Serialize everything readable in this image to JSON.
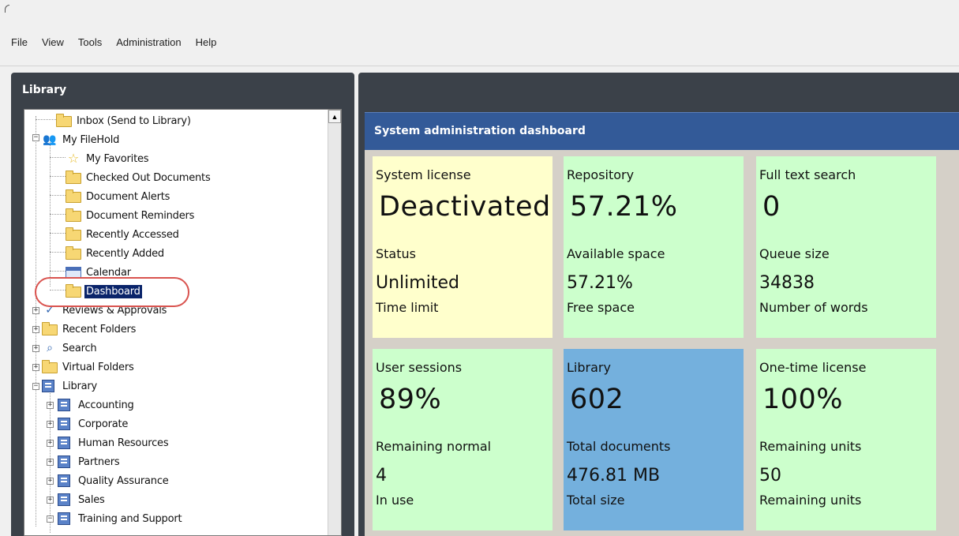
{
  "menu": [
    "File",
    "View",
    "Tools",
    "Administration",
    "Help"
  ],
  "library_pane": {
    "title": "Library",
    "tree": [
      {
        "label": "Inbox (Send to Library)",
        "icon": "folder-icon"
      },
      {
        "label": "My FileHold",
        "icon": "users-icon"
      },
      {
        "label": "My Favorites",
        "icon": "star-icon"
      },
      {
        "label": "Checked Out Documents",
        "icon": "folder-icon"
      },
      {
        "label": "Document Alerts",
        "icon": "folder-icon"
      },
      {
        "label": "Document Reminders",
        "icon": "folder-icon"
      },
      {
        "label": "Recently Accessed",
        "icon": "folder-icon"
      },
      {
        "label": "Recently Added",
        "icon": "folder-icon"
      },
      {
        "label": "Calendar",
        "icon": "calendar-icon"
      },
      {
        "label": "Dashboard",
        "icon": "folder-icon"
      },
      {
        "label": "Reviews & Approvals",
        "icon": "approval-icon"
      },
      {
        "label": "Recent Folders",
        "icon": "folders-icon"
      },
      {
        "label": "Search",
        "icon": "search-icon"
      },
      {
        "label": "Virtual Folders",
        "icon": "folders-icon"
      },
      {
        "label": "Library",
        "icon": "library-icon"
      },
      {
        "label": "Accounting",
        "icon": "cabinet-icon"
      },
      {
        "label": "Corporate",
        "icon": "cabinet-icon"
      },
      {
        "label": "Human Resources",
        "icon": "cabinet-icon"
      },
      {
        "label": "Partners",
        "icon": "cabinet-icon"
      },
      {
        "label": "Quality Assurance",
        "icon": "cabinet-icon"
      },
      {
        "label": "Sales",
        "icon": "cabinet-icon"
      },
      {
        "label": "Training and Support",
        "icon": "cabinet-icon"
      }
    ],
    "selected_item": "Dashboard"
  },
  "dashboard": {
    "title": "System administration dashboard",
    "cards": [
      {
        "title": "System license",
        "big": "Deactivated",
        "sub": "Status",
        "mid": "Unlimited",
        "foot": "Time limit",
        "color": "#ffffcc"
      },
      {
        "title": "Repository",
        "big": "57.21%",
        "sub": "Available space",
        "mid": "57.21%",
        "foot": "Free space",
        "color": "#ccffcc"
      },
      {
        "title": "Full text search",
        "big": "0",
        "sub": "Queue size",
        "mid": "34838",
        "foot": "Number of words",
        "color": "#ccffcc"
      },
      {
        "title": "User sessions",
        "big": "89%",
        "sub": "Remaining normal",
        "mid": "4",
        "foot": "In use",
        "color": "#ccffcc"
      },
      {
        "title": "Library",
        "big": "602",
        "sub": "Total documents",
        "mid": "476.81 MB",
        "foot": "Total size",
        "color": "#74b0dd"
      },
      {
        "title": "One-time license",
        "big": "100%",
        "sub": "Remaining units",
        "mid": "50",
        "foot": "Remaining units",
        "color": "#ccffcc"
      }
    ]
  }
}
